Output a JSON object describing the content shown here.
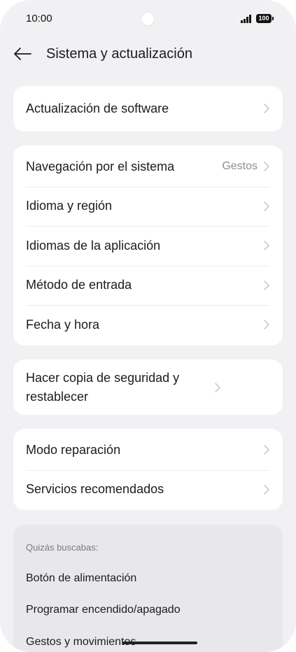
{
  "status_bar": {
    "time": "10:00",
    "battery_level": "100"
  },
  "header": {
    "title": "Sistema y actualización"
  },
  "groups": [
    {
      "items": [
        {
          "label": "Actualización de software"
        }
      ]
    },
    {
      "items": [
        {
          "label": "Navegación por el sistema",
          "value": "Gestos"
        },
        {
          "label": "Idioma y región"
        },
        {
          "label": "Idiomas de la aplicación"
        },
        {
          "label": "Método de entrada"
        },
        {
          "label": "Fecha y hora"
        }
      ]
    },
    {
      "items": [
        {
          "label": "Hacer copia de seguridad y restablecer"
        }
      ]
    },
    {
      "items": [
        {
          "label": "Modo reparación"
        },
        {
          "label": "Servicios recomendados"
        }
      ]
    }
  ],
  "suggestions": {
    "heading": "Quizás buscabas:",
    "items": [
      "Botón de alimentación",
      "Programar encendido/apagado",
      "Gestos y movimientos"
    ]
  },
  "icons": {
    "back": "back-arrow-icon",
    "row_chevron": "chevron-right-icon",
    "signal": "signal-icon",
    "battery": "battery-icon"
  },
  "theme": {
    "background": "#f1f1f3",
    "card": "#ffffff",
    "suggestion_card": "#e8e8ea",
    "text": "#1c1c1e",
    "secondary_text": "#8e8e93"
  }
}
